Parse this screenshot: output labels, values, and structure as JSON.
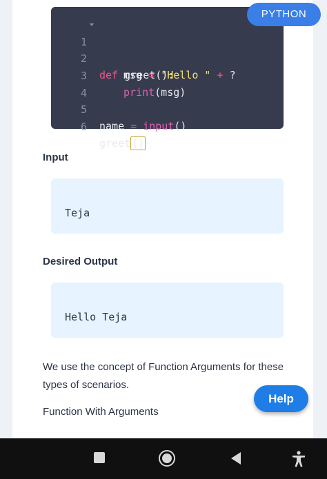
{
  "code": {
    "language_badge": "PYTHON",
    "lines": [
      {
        "num": "1",
        "tokens": {
          "kw": "def",
          "name": "greet():"
        }
      },
      {
        "num": "2",
        "tokens": {
          "var": "msg",
          "eq": "=",
          "str": "\"Hello \"",
          "plus": "+",
          "q": "?"
        }
      },
      {
        "num": "3",
        "tokens": {
          "call": "print",
          "arg": "(msg)"
        }
      },
      {
        "num": "4"
      },
      {
        "num": "5",
        "tokens": {
          "var": "name",
          "eq": "=",
          "call": "input",
          "paren": "()"
        }
      },
      {
        "num": "6",
        "tokens": {
          "name": "greet",
          "paren": "()"
        }
      }
    ]
  },
  "input_section": {
    "label": "Input",
    "value": "Teja"
  },
  "output_section": {
    "label": "Desired Output",
    "value": "Hello Teja"
  },
  "paragraph": "We use the concept of Function Arguments for these types of scenarios.",
  "subheading": "Function With Arguments",
  "help_button": "Help",
  "navbar": {
    "icons": [
      "recent-apps-icon",
      "home-icon",
      "back-icon",
      "accessibility-icon"
    ]
  },
  "colors": {
    "badge": "#3a7ee8",
    "code_bg": "#363c4e",
    "io_bg": "#e7f3fe",
    "help": "#1e7de6"
  }
}
